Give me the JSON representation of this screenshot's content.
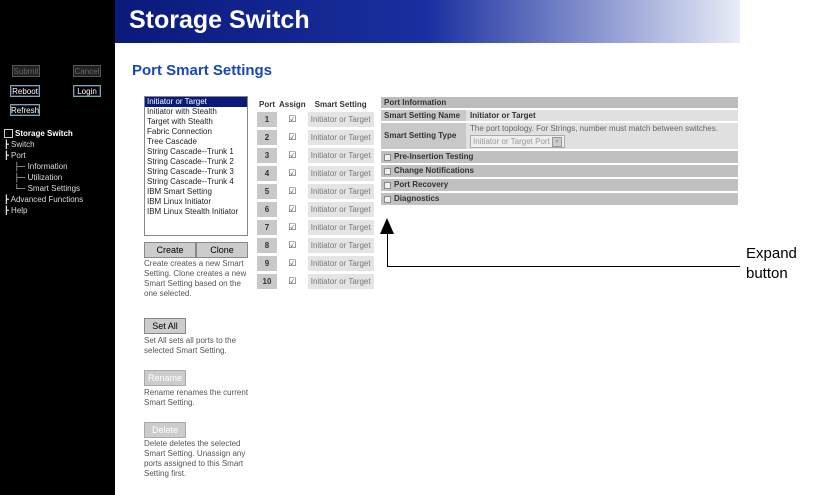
{
  "header": {
    "title": "Storage Switch"
  },
  "page_title": "Port Smart Settings",
  "nav": {
    "submit": "Submit",
    "cancel": "Cancel",
    "reboot": "Reboot",
    "login": "Login",
    "refresh": "Refresh",
    "tree": {
      "root": "Storage Switch",
      "switch": "Switch",
      "port": "Port",
      "information": "Information",
      "utilization": "Utilization",
      "smart_settings": "Smart Settings",
      "advanced": "Advanced Functions",
      "help": "Help"
    }
  },
  "settings_list": [
    "Initiator or Target",
    "Initiator with Stealth",
    "Target with Stealth",
    "Fabric Connection",
    "Tree Cascade",
    "String Cascade--Trunk 1",
    "String Cascade--Trunk 2",
    "String Cascade--Trunk 3",
    "String Cascade--Trunk 4",
    "IBM Smart Setting",
    "IBM Linux Initiator",
    "IBM Linux Stealth Initiator"
  ],
  "buttons": {
    "create": "Create",
    "clone": "Clone",
    "set_all": "Set All",
    "rename": "Rename",
    "delete": "Delete"
  },
  "descriptions": {
    "create_clone": "Create creates a new Smart Setting. Clone creates a new Smart Setting based on the one selected.",
    "set_all": "Set All sets all ports to the selected Smart Setting.",
    "rename": "Rename renames the current Smart Setting.",
    "delete": "Delete deletes the selected Smart Setting. Unassign any ports assigned to this Smart Setting first."
  },
  "port_table": {
    "headers": [
      "Port",
      "Assign",
      "Smart Setting"
    ],
    "check_glyph": "☑",
    "rows": [
      {
        "port": "1",
        "setting": "Initiator or Target"
      },
      {
        "port": "2",
        "setting": "Initiator or Target"
      },
      {
        "port": "3",
        "setting": "Initiator or Target"
      },
      {
        "port": "4",
        "setting": "Initiator or Target"
      },
      {
        "port": "5",
        "setting": "Initiator or Target"
      },
      {
        "port": "6",
        "setting": "Initiator or Target"
      },
      {
        "port": "7",
        "setting": "Initiator or Target"
      },
      {
        "port": "8",
        "setting": "Initiator or Target"
      },
      {
        "port": "9",
        "setting": "Initiator or Target"
      },
      {
        "port": "10",
        "setting": "Initiator or Target"
      }
    ]
  },
  "port_info": {
    "header": "Port Information",
    "name_label": "Smart Setting Name",
    "name_value": "Initiator or Target",
    "type_label": "Smart Setting Type",
    "type_note": "The port topology. For Strings, number must match between switches.",
    "type_select": "Initiator or Target Port",
    "sections": [
      "Pre-Insertion Testing",
      "Change Notifications",
      "Port Recovery",
      "Diagnostics"
    ]
  },
  "callout": {
    "line1": "Expand",
    "line2": "button"
  }
}
